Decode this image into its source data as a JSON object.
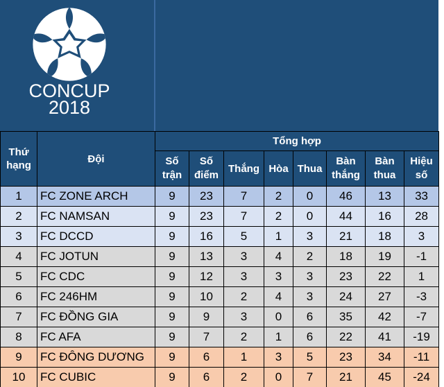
{
  "logo": {
    "icon": "soccer-ball-icon",
    "title": "CONCUP",
    "year": "2018"
  },
  "table": {
    "header": {
      "rank": "Thứ hạng",
      "team": "Đội",
      "group": "Tổng hợp",
      "columns": [
        "Số trận",
        "Số điểm",
        "Thắng",
        "Hòa",
        "Thua",
        "Bàn thắng",
        "Bàn thua",
        "Hiệu số"
      ]
    },
    "rows": [
      {
        "rank": "1",
        "team": "FC ZONE ARCH",
        "played": "9",
        "points": "23",
        "won": "7",
        "drawn": "2",
        "lost": "0",
        "gf": "46",
        "ga": "13",
        "gd": "33"
      },
      {
        "rank": "2",
        "team": "FC NAMSAN",
        "played": "9",
        "points": "23",
        "won": "7",
        "drawn": "2",
        "lost": "0",
        "gf": "44",
        "ga": "16",
        "gd": "28"
      },
      {
        "rank": "3",
        "team": "FC DCCD",
        "played": "9",
        "points": "16",
        "won": "5",
        "drawn": "1",
        "lost": "3",
        "gf": "21",
        "ga": "18",
        "gd": "3"
      },
      {
        "rank": "4",
        "team": "FC JOTUN",
        "played": "9",
        "points": "13",
        "won": "3",
        "drawn": "4",
        "lost": "2",
        "gf": "18",
        "ga": "19",
        "gd": "-1"
      },
      {
        "rank": "5",
        "team": "FC CDC",
        "played": "9",
        "points": "12",
        "won": "3",
        "drawn": "3",
        "lost": "3",
        "gf": "23",
        "ga": "22",
        "gd": "1"
      },
      {
        "rank": "6",
        "team": "FC 246HM",
        "played": "9",
        "points": "10",
        "won": "2",
        "drawn": "4",
        "lost": "3",
        "gf": "24",
        "ga": "27",
        "gd": "-3"
      },
      {
        "rank": "7",
        "team": "FC ĐỒNG GIA",
        "played": "9",
        "points": "9",
        "won": "3",
        "drawn": "0",
        "lost": "6",
        "gf": "35",
        "ga": "42",
        "gd": "-7"
      },
      {
        "rank": "8",
        "team": "FC AFA",
        "played": "9",
        "points": "7",
        "won": "2",
        "drawn": "1",
        "lost": "6",
        "gf": "22",
        "ga": "41",
        "gd": "-19"
      },
      {
        "rank": "9",
        "team": "FC ĐÔNG DƯƠNG",
        "played": "9",
        "points": "6",
        "won": "1",
        "drawn": "3",
        "lost": "5",
        "gf": "23",
        "ga": "34",
        "gd": "-11"
      },
      {
        "rank": "10",
        "team": "FC CUBIC",
        "played": "9",
        "points": "6",
        "won": "2",
        "drawn": "0",
        "lost": "7",
        "gf": "21",
        "ga": "45",
        "gd": "-24"
      }
    ]
  },
  "colors": {
    "header_bg": "#1f4e79",
    "top2_row": "#b4c7e7",
    "third_row": "#dae3f3",
    "mid_rows": "#d9d9d9",
    "bottom_rows": "#f8cbad"
  }
}
